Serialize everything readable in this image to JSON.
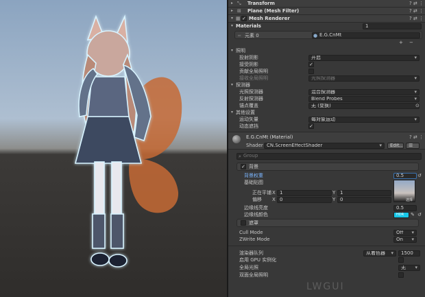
{
  "components": {
    "transform": "Transform",
    "mesh_filter": "Plane (Mesh Filter)",
    "mesh_renderer": "Mesh Renderer"
  },
  "materials": {
    "label": "Materials",
    "count": "1",
    "element_label": "元素 0",
    "element_value": "E.G.CnMt",
    "plus": "+",
    "minus": "−"
  },
  "lighting": {
    "section": "照明",
    "cast_shadows_label": "投射阴影",
    "cast_shadows_value": "开启",
    "receive_shadows_label": "接受阴影",
    "contribute_gi_label": "贡献全局照明",
    "receive_gi_label": "接收全局照明",
    "receive_gi_value": "光照探测器"
  },
  "probes": {
    "section": "探测器",
    "light_probes_label": "光照探测器",
    "light_probes_value": "混合探测器",
    "reflection_probes_label": "反射探测器",
    "reflection_probes_value": "Blend Probes",
    "anchor_label": "锚点覆盖",
    "anchor_value": "无 (变换)"
  },
  "additional": {
    "section": "其他设置",
    "motion_vectors_label": "运动矢量",
    "motion_vectors_value": "每对象运动",
    "dynamic_occlusion_label": "动态遮挡"
  },
  "material": {
    "name": "E.G.CnMt (Material)",
    "shader_label": "Shader",
    "shader_value": "CN.ScreenEffectShader",
    "edit_label": "Edit...",
    "list_label": "☰"
  },
  "lwgui": {
    "search_placeholder": "Group",
    "background_group": "背景",
    "bg_weight_label": "背景权重",
    "bg_weight_value": "0.5",
    "base_map_label": "基础贴图",
    "base_map_select": "选择",
    "tiling_label": "正在平铺",
    "tiling_x": "1",
    "tiling_y": "1",
    "offset_label": "偏移",
    "offset_x": "0",
    "offset_y": "0",
    "x_label": "X",
    "y_label": "Y",
    "edge_brightness_label": "边缘线亮度",
    "edge_brightness_value": "0.5",
    "edge_color_label": "边缘线颜色",
    "edge_color_value": "HDR",
    "mask_group": "遮罩",
    "cull_mode_label": "Cull Mode",
    "cull_mode_value": "Off",
    "zwrite_label": "ZWrite Mode",
    "zwrite_value": "On",
    "render_queue_label": "渲染器队列",
    "render_queue_value": "从着色器",
    "render_queue_number": "1500",
    "gpu_instancing_label": "启用 GPU 实例化",
    "global_illum_label": "全局光照",
    "global_illum_value": "无",
    "double_sided_label": "双面全局照明",
    "watermark": "LWGUI"
  },
  "colors": {
    "edge_color": "#17c7e8",
    "accent": "#3a72b0"
  }
}
